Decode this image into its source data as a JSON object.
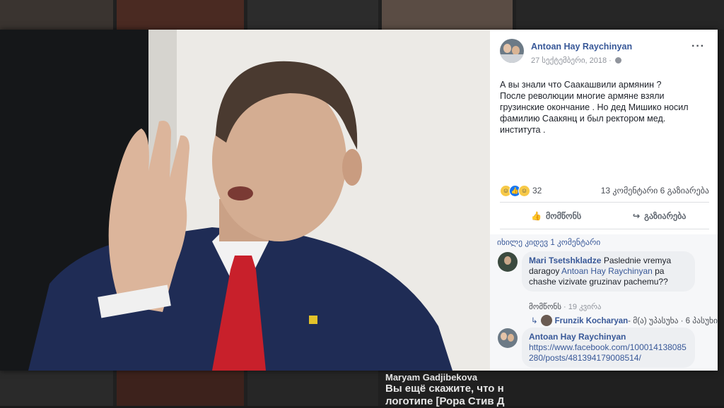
{
  "post": {
    "author": "Antoan Hay Raychinyan",
    "date": "27 სექტემბერი, 2018 ·",
    "more": "···",
    "text_lines": [
      "А вы знали что Саакашвили армянин ?",
      "После революции многие армяне взяли",
      "грузинские окончание . Но дед Мишико носил",
      "фамилию Саакянц и был ректором мед.",
      "института ."
    ],
    "reactions_count": "32",
    "comments_shares": "13 კომენტარი  6 გაზიარება",
    "like_label": "მომწონს",
    "share_label": "გაზიარება"
  },
  "comments": {
    "previous": "იხილე კიდევ 1 კომენტარი",
    "c1": {
      "name": "Mari Tsetshkladze",
      "text_before": " Paslednie vremya daragoy ",
      "mention": "Antoan Hay Raychinyan",
      "text_after": " pa chashe vizivate gruzinav pachemu??",
      "like": "მომწონს",
      "time": "19 კვირა"
    },
    "reply": {
      "name": "Frunzik Kocharyan",
      "text": "- მ(ა) უპასუხა · 6 პასუხი"
    },
    "c2": {
      "name": "Antoan Hay Raychinyan",
      "link": "https://www.facebook.com/100014138085280/posts/481394179008514/"
    }
  },
  "background": {
    "name": "Maryam Gadjibekova",
    "line1": "Вы ещё скажите, что н",
    "line2": "логотипе [Рора Стив Д"
  },
  "icons": {
    "like": "thumbs-up-icon",
    "share": "share-arrow-icon",
    "globe": "globe-icon",
    "reply": "reply-arrow-icon"
  }
}
